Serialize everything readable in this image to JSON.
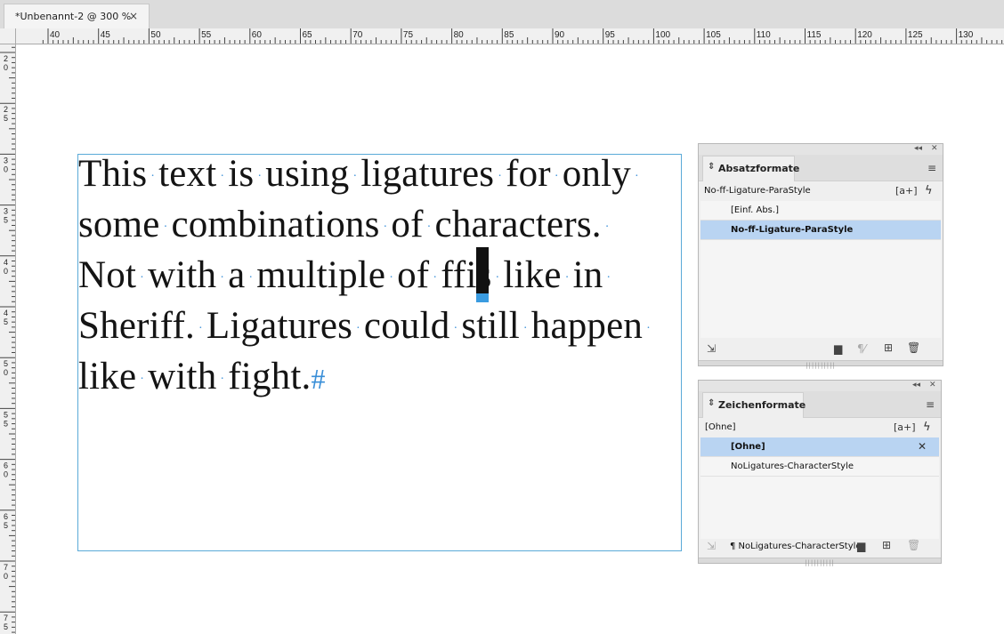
{
  "document": {
    "tab_title": "*Unbenannt-2 @ 300 %",
    "tab_close": "×"
  },
  "rulers": {
    "horizontal_labels": [
      "40",
      "45",
      "50",
      "55",
      "60",
      "65",
      "70",
      "75",
      "80",
      "85",
      "90",
      "95",
      "100",
      "105",
      "110",
      "115",
      "120",
      "125",
      "130"
    ],
    "vertical_labels": [
      "20",
      "25",
      "30",
      "35",
      "40",
      "45",
      "50",
      "55",
      "60",
      "65",
      "70",
      "75"
    ]
  },
  "text_frame": {
    "lines": [
      [
        "This",
        "text",
        "is",
        "using",
        "ligatures",
        "for",
        "only",
        ""
      ],
      [
        "some",
        "combinations",
        "of",
        "characters.",
        ""
      ],
      [
        "Not",
        "with",
        "a",
        "multiple",
        "of",
        "ffis",
        "like",
        "in",
        ""
      ],
      [
        "Sheriff.",
        "Ligatures",
        "could",
        "still",
        "happen",
        ""
      ],
      [
        "like",
        "with",
        "fight."
      ]
    ],
    "space_marker": "·",
    "end_of_story": "#"
  },
  "paragraph_panel": {
    "tab_label": "Absatzformate",
    "collapse_icon": "◂◂",
    "close_icon": "✕",
    "menu_icon": "≡",
    "active_style": "No-ff-Ligature-ParaStyle",
    "new_from_selection_icon": "[a+]",
    "quick_apply_icon": "ϟ",
    "items": [
      {
        "label": "[Einf. Abs.]",
        "selected": false
      },
      {
        "label": "No-ff-Ligature-ParaStyle",
        "selected": true
      }
    ],
    "footer": {
      "load_icon": "⇲",
      "group_icon": "▆",
      "clear_override_icon": "¶⁄",
      "new_icon": "⊞",
      "delete_icon": "🗑"
    }
  },
  "character_panel": {
    "tab_label": "Zeichenformate",
    "collapse_icon": "◂◂",
    "close_icon": "✕",
    "menu_icon": "≡",
    "active_style": "[Ohne]",
    "new_from_selection_icon": "[a+]",
    "quick_apply_icon": "ϟ",
    "items": [
      {
        "label": "[Ohne]",
        "selected": true,
        "badge": "✕"
      },
      {
        "label": "NoLigatures-CharacterStyle",
        "selected": false
      }
    ],
    "footer": {
      "load_icon": "⇲",
      "current_style": "¶ NoLigatures-CharacterStyle",
      "group_icon": "▆",
      "new_icon": "⊞",
      "delete_icon": "🗑"
    }
  },
  "colors": {
    "frame_border": "#5aaad8",
    "space_marker": "#3a8fd8",
    "selection": "#b9d4f2"
  }
}
